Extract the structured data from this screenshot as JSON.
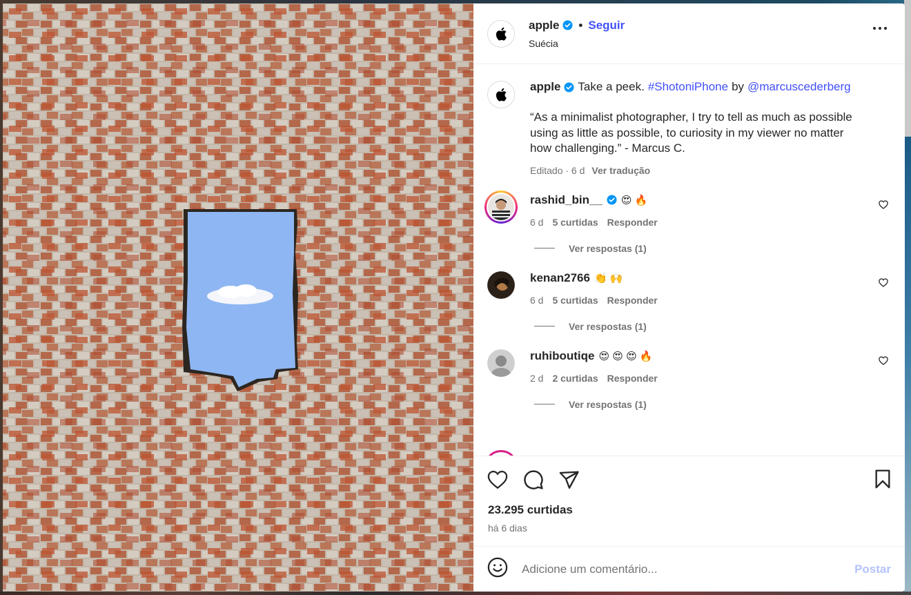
{
  "header": {
    "username": "apple",
    "separator": "•",
    "follow_label": "Seguir",
    "location": "Suécia"
  },
  "caption": {
    "username": "apple",
    "text": "Take a peek.",
    "hashtag": "#ShotoniPhone",
    "by": "by",
    "mention": "@marcuscederberg",
    "quote": "“As a minimalist photographer, I try to tell as much as possible using as little as possible, to curiosity in my viewer no matter how challenging.” - Marcus C.",
    "edited": "Editado · 6 d",
    "translate": "Ver tradução"
  },
  "comments": [
    {
      "username": "rashid_bin__",
      "verified": true,
      "text": "😍 🔥",
      "age": "6 d",
      "likes": "5 curtidas",
      "reply": "Responder",
      "replies": "Ver respostas (1)"
    },
    {
      "username": "kenan2766",
      "verified": false,
      "text": "👏 🙌",
      "age": "6 d",
      "likes": "5 curtidas",
      "reply": "Responder",
      "replies": "Ver respostas (1)"
    },
    {
      "username": "ruhiboutiqe",
      "verified": false,
      "text": "😍 😍 😍 🔥",
      "age": "2 d",
      "likes": "2 curtidas",
      "reply": "Responder",
      "replies": "Ver respostas (1)"
    }
  ],
  "stats": {
    "likes": "23.295 curtidas",
    "time": "há 6 dias"
  },
  "add_comment": {
    "placeholder": "Adicione um comentário...",
    "post_label": "Postar"
  },
  "colors": {
    "accent": "#4150f7",
    "muted": "#737373",
    "verified": "#0095f6",
    "post_disabled": "#b3c3fb"
  }
}
